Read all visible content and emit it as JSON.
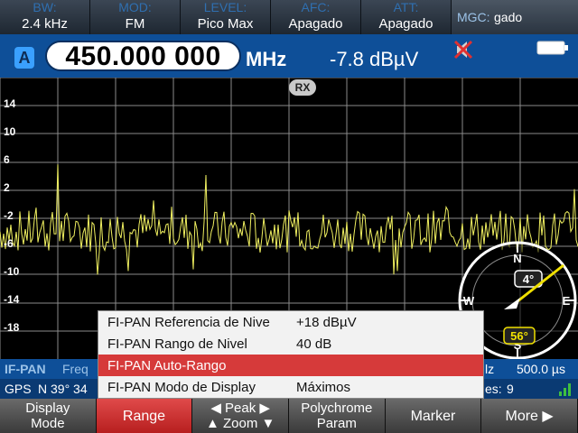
{
  "top_params": [
    {
      "label": "BW:",
      "value": "2.4 kHz"
    },
    {
      "label": "MOD:",
      "value": "FM"
    },
    {
      "label": "LEVEL:",
      "value": "Pico Max"
    },
    {
      "label": "AFC:",
      "value": "Apagado"
    },
    {
      "label": "ATT:",
      "value": "Apagado"
    }
  ],
  "mgc": {
    "label": "MGC:",
    "value": "gado"
  },
  "antenna_badge": "A",
  "frequency": "450.000 000",
  "frequency_unit": "MHz",
  "level": "-7.8 dBµV",
  "rx_badge": "RX",
  "y_ticks": [
    "14",
    "10",
    "6",
    "2",
    "-2",
    "-6",
    "-10",
    "-14",
    "-18"
  ],
  "compass": {
    "north": "N",
    "south": "S",
    "east": "E",
    "west": "W",
    "heading_value": "4°",
    "bearing_value": "56°",
    "heading_color": "#ffffff",
    "bearing_color": "#f0e000"
  },
  "status": {
    "ifpan_label": "IF-PAN",
    "freq_label": "Freq",
    "hz_suffix": "lz",
    "time_value": "500.0 µs",
    "gps_label": "GPS",
    "gps_coord": "N 39° 34",
    "sat_label": "es:",
    "sat_value": "9"
  },
  "menu": {
    "items": [
      {
        "name": "FI-PAN Referencia de Nive",
        "value": "+18 dBµV"
      },
      {
        "name": "FI-PAN Rango de Nivel",
        "value": "40 dB"
      },
      {
        "name": "FI-PAN Auto-Rango",
        "value": ""
      },
      {
        "name": "FI-PAN Modo de Display",
        "value": "Máximos"
      }
    ],
    "selected_index": 2
  },
  "softkeys": [
    {
      "line1": "Display",
      "line2": "Mode"
    },
    {
      "line1": "Range",
      "line2": ""
    },
    {
      "line1": "◀ Peak ▶",
      "line2": "▲ Zoom ▼"
    },
    {
      "line1": "Polychrome",
      "line2": "Param"
    },
    {
      "line1": "Marker",
      "line2": ""
    },
    {
      "line1": "More ▶",
      "line2": ""
    }
  ],
  "colors": {
    "accent_blue": "#0e4f98",
    "trace_yellow": "#f0f060",
    "grid": "#8a8a8a",
    "selection_red": "#d63a3a"
  }
}
